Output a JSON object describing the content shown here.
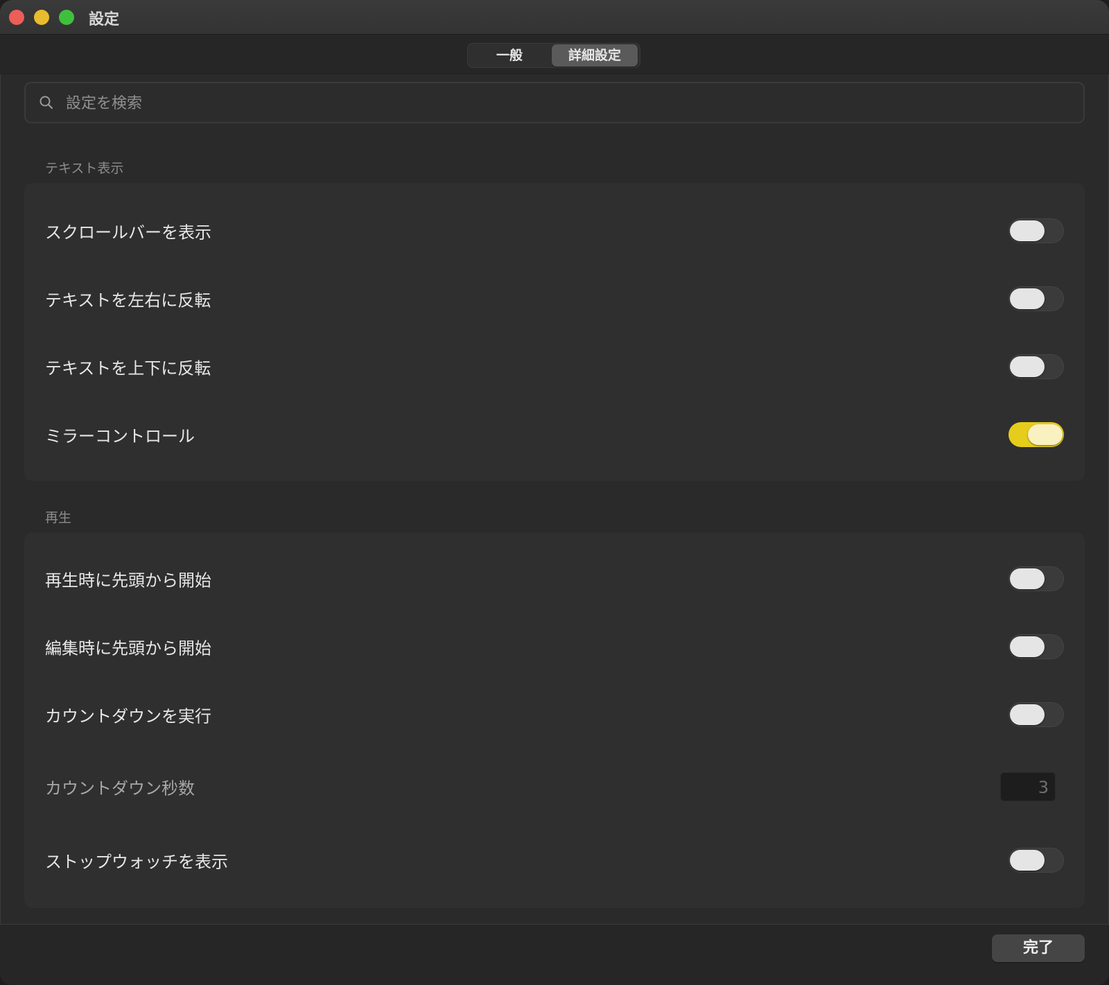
{
  "window": {
    "title": "設定"
  },
  "tabs": [
    {
      "label": "一般",
      "selected": false
    },
    {
      "label": "詳細設定",
      "selected": true
    }
  ],
  "search": {
    "placeholder": "設定を検索",
    "value": ""
  },
  "sections": [
    {
      "header": "テキスト表示",
      "items": [
        {
          "label": "スクロールバーを表示",
          "type": "toggle",
          "on": false
        },
        {
          "label": "テキストを左右に反転",
          "type": "toggle",
          "on": false
        },
        {
          "label": "テキストを上下に反転",
          "type": "toggle",
          "on": false
        },
        {
          "label": "ミラーコントロール",
          "type": "toggle",
          "on": true
        }
      ]
    },
    {
      "header": "再生",
      "items": [
        {
          "label": "再生時に先頭から開始",
          "type": "toggle",
          "on": false
        },
        {
          "label": "編集時に先頭から開始",
          "type": "toggle",
          "on": false
        },
        {
          "label": "カウントダウンを実行",
          "type": "toggle",
          "on": false
        },
        {
          "label": "カウントダウン秒数",
          "type": "number",
          "value": "3",
          "disabled": true
        },
        {
          "label": "ストップウォッチを表示",
          "type": "toggle",
          "on": false
        }
      ]
    }
  ],
  "footer": {
    "done_label": "完了"
  },
  "colors": {
    "toggle_on": "#e6cd1b",
    "traffic_close": "#ec5e57",
    "traffic_minimize": "#e9bb2f",
    "traffic_zoom": "#3fc03c"
  }
}
